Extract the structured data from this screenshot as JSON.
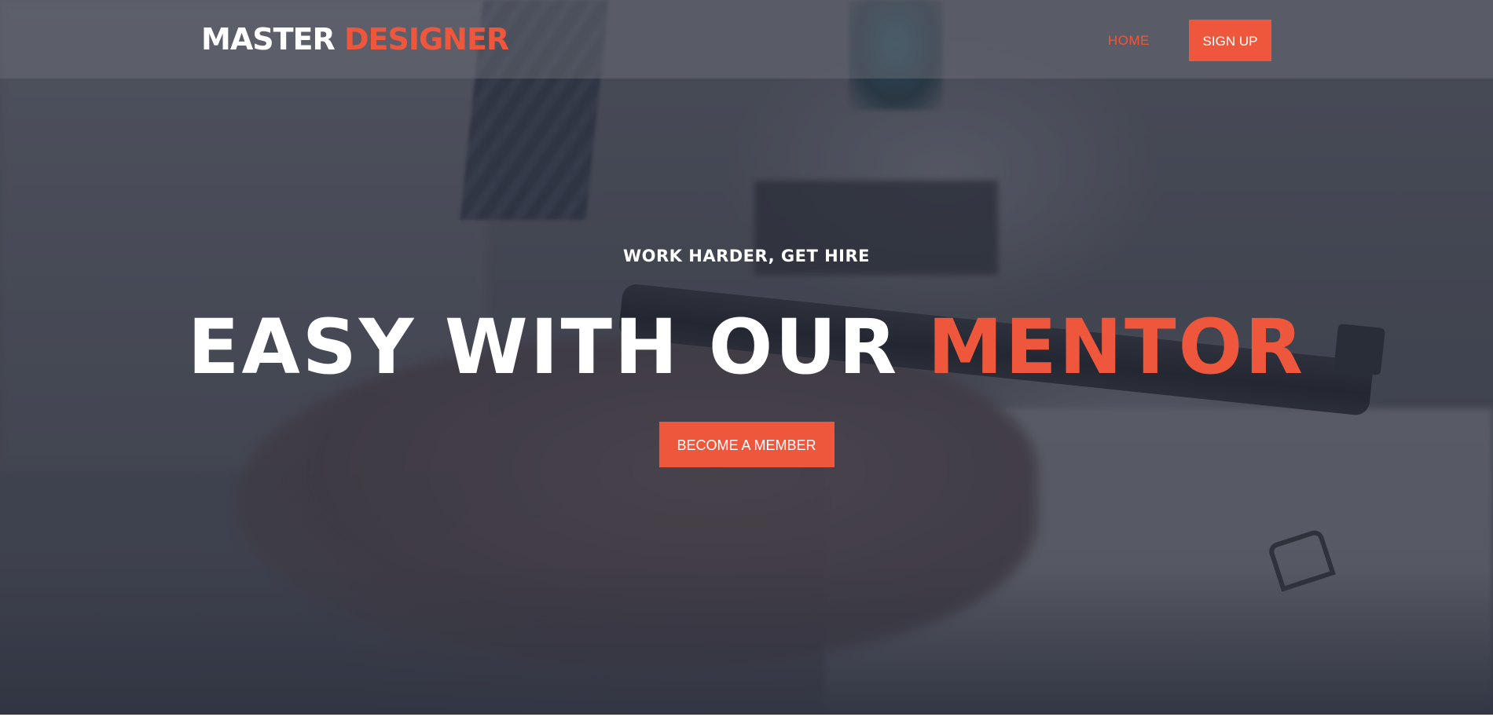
{
  "brand": {
    "logo_part1": "MASTER",
    "logo_part2": "DESIGNER"
  },
  "nav": {
    "home_label": "HOME",
    "signup_label": "SIGN UP"
  },
  "hero": {
    "kicker": "WORK HARDER, GET HIRE",
    "headline_part1": "EASY WITH OUR",
    "headline_part2": "MENTOR",
    "cta_label": "BECOME A MEMBER"
  },
  "colors": {
    "accent": "#ee573b",
    "text_light": "#ffffff",
    "header_bg": "rgba(110,114,122,0.45)"
  }
}
